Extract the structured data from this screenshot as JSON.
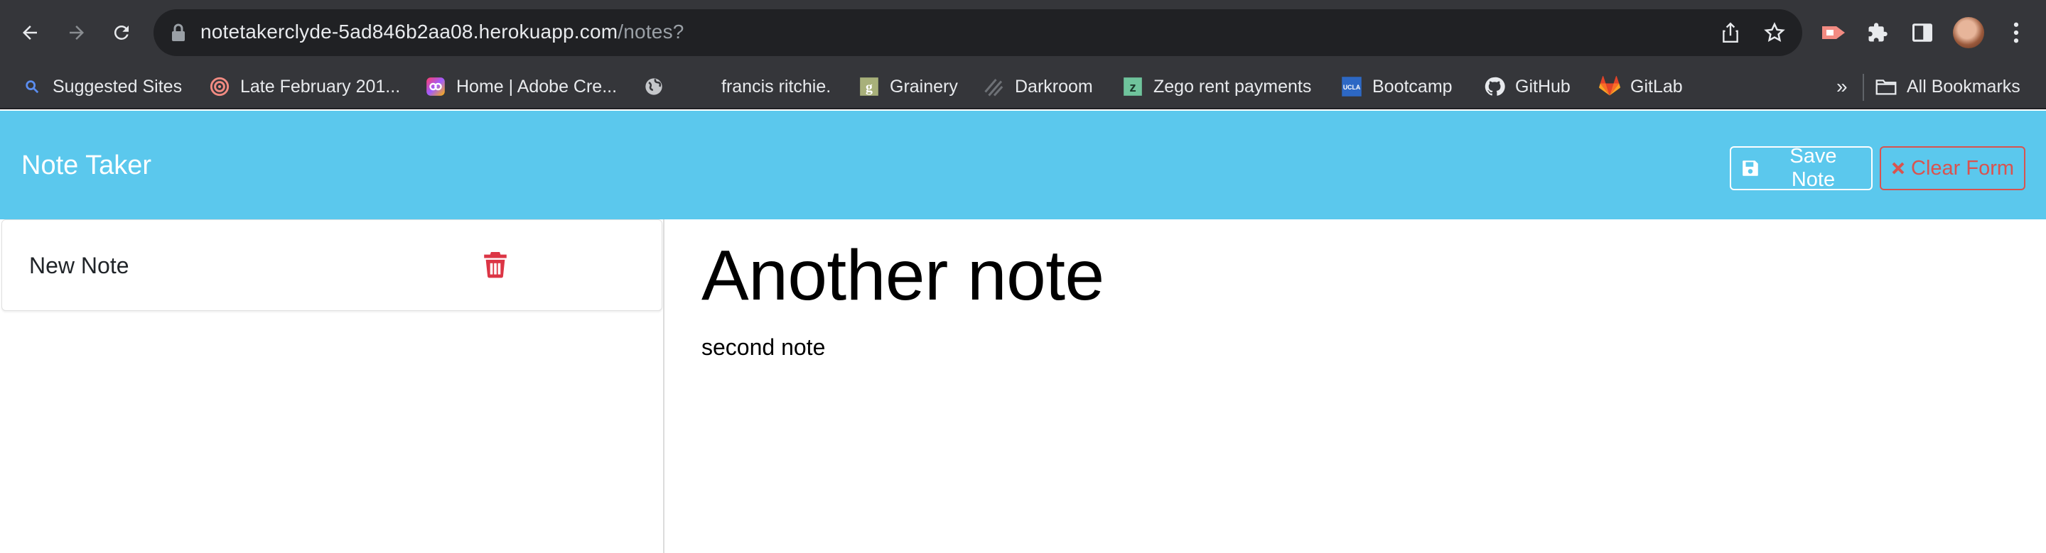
{
  "browser": {
    "url_host": "notetakerclyde-5ad846b2aa08.herokuapp.com",
    "url_path": "/notes?",
    "nav_icons": [
      "back-icon",
      "forward-icon",
      "reload-icon"
    ],
    "toolbar_icons": [
      "share-icon",
      "star-icon",
      "extension-icon",
      "puzzle-icon",
      "sidebar-icon",
      "avatar",
      "kebab-menu-icon"
    ],
    "bookmarks": [
      {
        "label": "Suggested Sites",
        "icon": "search-icon"
      },
      {
        "label": "Late February 201...",
        "icon": "target-icon"
      },
      {
        "label": "Home | Adobe Cre...",
        "icon": "adobe-cc-icon"
      },
      {
        "label": "",
        "icon": "globe-icon"
      },
      {
        "label": "francis ritchie.",
        "icon": ""
      },
      {
        "label": "Grainery",
        "icon": "grainery-icon"
      },
      {
        "label": "Darkroom",
        "icon": "darkroom-icon"
      },
      {
        "label": "Zego rent payments",
        "icon": "zego-icon"
      },
      {
        "label": "Bootcamp",
        "icon": "ucla-icon"
      },
      {
        "label": "GitHub",
        "icon": "github-icon"
      },
      {
        "label": "GitLab",
        "icon": "gitlab-icon"
      }
    ],
    "overflow": "»",
    "all_bookmarks": "All Bookmarks",
    "colors": {
      "chrome": "#35363a",
      "omnibox": "#202124"
    }
  },
  "app": {
    "title": "Note Taker",
    "save_label": "Save Note",
    "clear_label": "Clear Form",
    "colors": {
      "header": "#5bc8ed",
      "danger": "#d9534f"
    }
  },
  "sidebar": {
    "items": [
      {
        "label": "New Note",
        "icon": "trash-icon"
      }
    ]
  },
  "note": {
    "title": "Another note",
    "text": "second note"
  }
}
